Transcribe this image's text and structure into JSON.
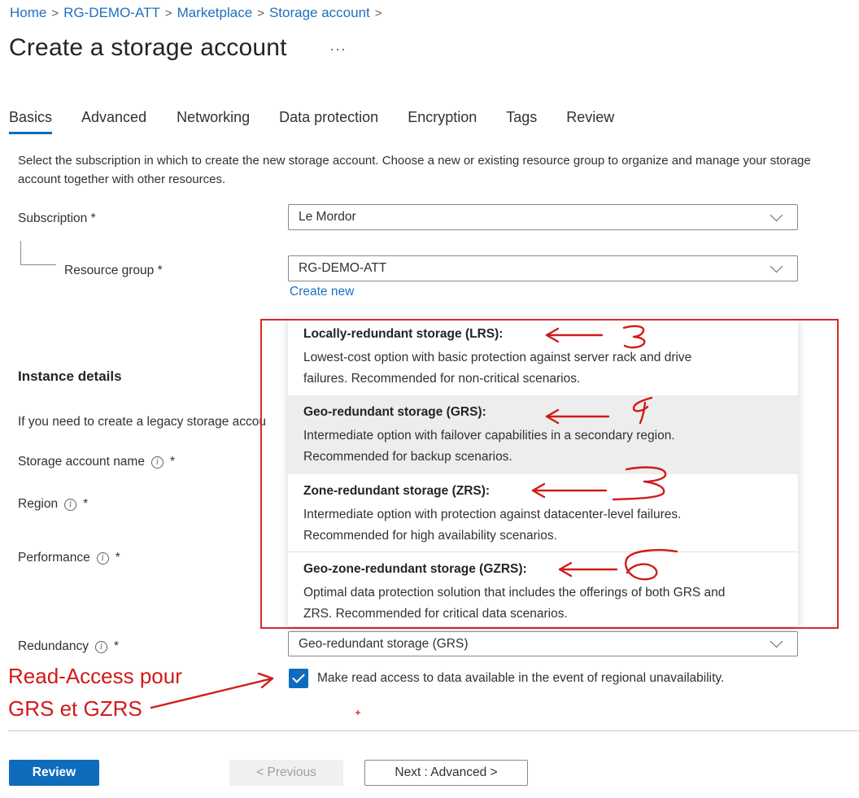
{
  "breadcrumb": [
    "Home",
    "RG-DEMO-ATT",
    "Marketplace",
    "Storage account"
  ],
  "page_title": "Create a storage account",
  "more_label": "···",
  "tabs": [
    "Basics",
    "Advanced",
    "Networking",
    "Data protection",
    "Encryption",
    "Tags",
    "Review"
  ],
  "active_tab": "Basics",
  "intro": "Select the subscription in which to create the new storage account. Choose a new or existing resource group to organize and manage your storage account together with other resources.",
  "project": {
    "subscription_label": "Subscription *",
    "subscription_value": "Le Mordor",
    "resource_group_label": "Resource group *",
    "resource_group_value": "RG-DEMO-ATT",
    "create_new": "Create new"
  },
  "instance": {
    "title": "Instance details",
    "legacy_text": "If you need to create a legacy storage accou",
    "name_label": "Storage account name",
    "region_label": "Region",
    "performance_label": "Performance",
    "redundancy_label": "Redundancy",
    "required_mark": "*",
    "info_glyph": "i",
    "redundancy_value": "Geo-redundant storage (GRS)"
  },
  "redundancy_options": [
    {
      "title": "Locally-redundant storage (LRS):",
      "line1": "Lowest-cost option with basic protection against server rack and drive",
      "line2": "failures. Recommended for non-critical scenarios."
    },
    {
      "title": "Geo-redundant storage (GRS):",
      "line1": "Intermediate option with failover capabilities in a secondary region.",
      "line2": "Recommended for backup scenarios."
    },
    {
      "title": "Zone-redundant storage (ZRS):",
      "line1": "Intermediate option with protection against datacenter-level failures.",
      "line2": "Recommended for high availability scenarios."
    },
    {
      "title": "Geo-zone-redundant storage (GZRS):",
      "line1": "Optimal data protection solution that includes the offerings of both GRS and",
      "line2": "ZRS. Recommended for critical data scenarios."
    }
  ],
  "selected_option_index": 1,
  "read_access": {
    "checked": true,
    "label": "Make read access to data available in the event of regional unavailability."
  },
  "annotation": {
    "line1": "Read-Access pour",
    "line2": "GRS et GZRS",
    "color": "#d11a1a"
  },
  "footer": {
    "review": "Review",
    "previous": "< Previous",
    "next": "Next : Advanced >"
  },
  "colors": {
    "accent": "#0f6cbd",
    "annotation_red": "#d42a2a"
  }
}
